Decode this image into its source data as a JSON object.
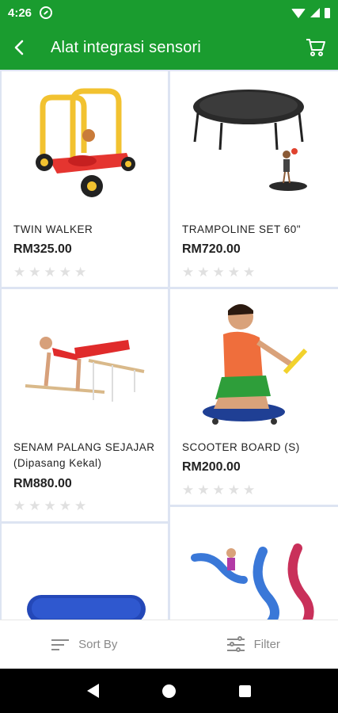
{
  "status_bar": {
    "time": "4:26"
  },
  "app_bar": {
    "title": "Alat integrasi sensori",
    "back_icon": "arrow-left-icon",
    "cart_icon": "cart-icon"
  },
  "products": [
    {
      "name": "TWIN WALKER",
      "price": "RM325.00",
      "rating": 0
    },
    {
      "name": "TRAMPOLINE SET 60\"",
      "price": "RM720.00",
      "rating": 0
    },
    {
      "name": "SENAM PALANG SEJAJAR (Dipasang Kekal)",
      "price": "RM880.00",
      "rating": 0
    },
    {
      "name": "SCOOTER BOARD (S)",
      "price": "RM200.00",
      "rating": 0
    }
  ],
  "bottom_bar": {
    "sort_label": "Sort By",
    "filter_label": "Filter"
  },
  "colors": {
    "primary": "#1a9c2f",
    "star_empty": "#e0e0e0",
    "grid_bg": "#dde4f2"
  }
}
